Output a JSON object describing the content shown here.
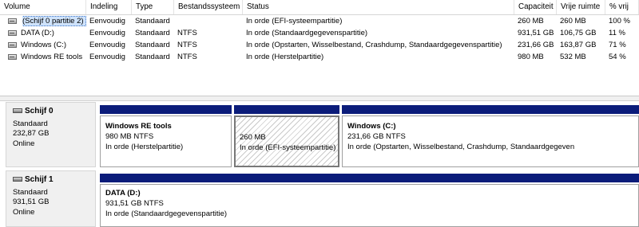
{
  "columns": [
    "Volume",
    "Indeling",
    "Type",
    "Bestandssysteem",
    "Status",
    "Capaciteit",
    "Vrije ruimte",
    "% vrij"
  ],
  "volumes": [
    {
      "name": "(Schijf 0 partitie 2)",
      "layout": "Eenvoudig",
      "type": "Standaard",
      "fs": "",
      "status": "In orde (EFI-systeempartitie)",
      "capacity": "260 MB",
      "free": "260 MB",
      "pct": "100 %",
      "selected": true
    },
    {
      "name": "DATA (D:)",
      "layout": "Eenvoudig",
      "type": "Standaard",
      "fs": "NTFS",
      "status": "In orde (Standaardgegevenspartitie)",
      "capacity": "931,51 GB",
      "free": "106,75 GB",
      "pct": "11 %"
    },
    {
      "name": "Windows (C:)",
      "layout": "Eenvoudig",
      "type": "Standaard",
      "fs": "NTFS",
      "status": "In orde (Opstarten, Wisselbestand, Crashdump, Standaardgegevenspartitie)",
      "capacity": "231,66 GB",
      "free": "163,87 GB",
      "pct": "71 %"
    },
    {
      "name": "Windows RE tools",
      "layout": "Eenvoudig",
      "type": "Standaard",
      "fs": "NTFS",
      "status": "In orde (Herstelpartitie)",
      "capacity": "980 MB",
      "free": "532 MB",
      "pct": "54 %"
    }
  ],
  "disks": [
    {
      "name": "Schijf 0",
      "type": "Standaard",
      "size": "232,87 GB",
      "state": "Online",
      "partitions": [
        {
          "title": "Windows RE tools",
          "size_fs": "980 MB NTFS",
          "status": "In orde (Herstelpartitie)"
        },
        {
          "title": "",
          "size_fs": "260 MB",
          "status": "In orde (EFI-systeempartitie)"
        },
        {
          "title": "Windows  (C:)",
          "size_fs": "231,66 GB NTFS",
          "status": "In orde (Opstarten, Wisselbestand, Crashdump, Standaardgegeven"
        }
      ]
    },
    {
      "name": "Schijf 1",
      "type": "Standaard",
      "size": "931,51 GB",
      "state": "Online",
      "partitions": [
        {
          "title": "DATA  (D:)",
          "size_fs": "931,51 GB NTFS",
          "status": "In orde (Standaardgegevenspartitie)"
        }
      ]
    }
  ],
  "colors": {
    "partition_bar": "#0b1c7a",
    "selection": "#cfe3fb"
  },
  "icons": {
    "volume": "drive-icon",
    "disk": "disk-icon"
  }
}
